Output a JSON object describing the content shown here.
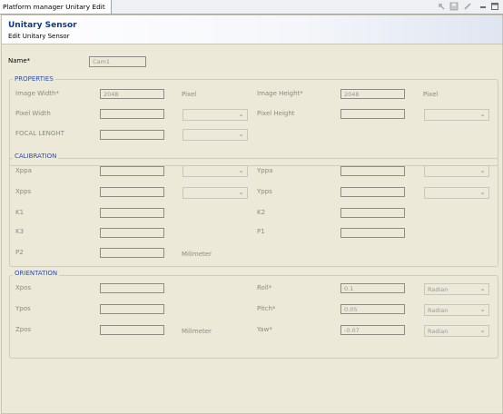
{
  "tab": {
    "label": "Platform manager Unitary Edit"
  },
  "header": {
    "title": "Unitary Sensor",
    "subtitle": "Edit Unitary Sensor"
  },
  "name": {
    "label": "Name*",
    "value": "Cam1"
  },
  "properties": {
    "title": "PROPERTIES",
    "image_width_label": "Image Width*",
    "image_width_value": "2048",
    "image_width_unit": "Pixel",
    "image_height_label": "Image Height*",
    "image_height_value": "2048",
    "image_height_unit": "Pixel",
    "pixel_width_label": "Pixel Width",
    "pixel_width_value": "",
    "pixel_height_label": "Pixel Height",
    "pixel_height_value": "",
    "focal_length_label": "FOCAL LENGHT",
    "focal_length_value": ""
  },
  "calibration": {
    "title": "CALIBRATION",
    "xppa_label": "Xppa",
    "yppa_label": "Yppa",
    "xpps_label": "Xpps",
    "ypps_label": "Ypps",
    "k1_label": "K1",
    "k2_label": "K2",
    "k3_label": "K3",
    "p1_label": "P1",
    "p2_label": "P2",
    "p2_unit": "Milimeter"
  },
  "orientation": {
    "title": "ORIENTATION",
    "xpos_label": "Xpos",
    "ypos_label": "Ypos",
    "zpos_label": "Zpos",
    "zpos_unit": "Milimeter",
    "roll_label": "Roll*",
    "roll_value": "0.1",
    "roll_unit": "Radian",
    "pitch_label": "Pitch*",
    "pitch_value": "0.05",
    "pitch_unit": "Radian",
    "yaw_label": "Yaw*",
    "yaw_value": "-0.07",
    "yaw_unit": "Radian"
  },
  "toolbar_icons": [
    "back-icon",
    "save-icon",
    "edit-icon",
    "minimize-icon",
    "maximize-icon"
  ]
}
